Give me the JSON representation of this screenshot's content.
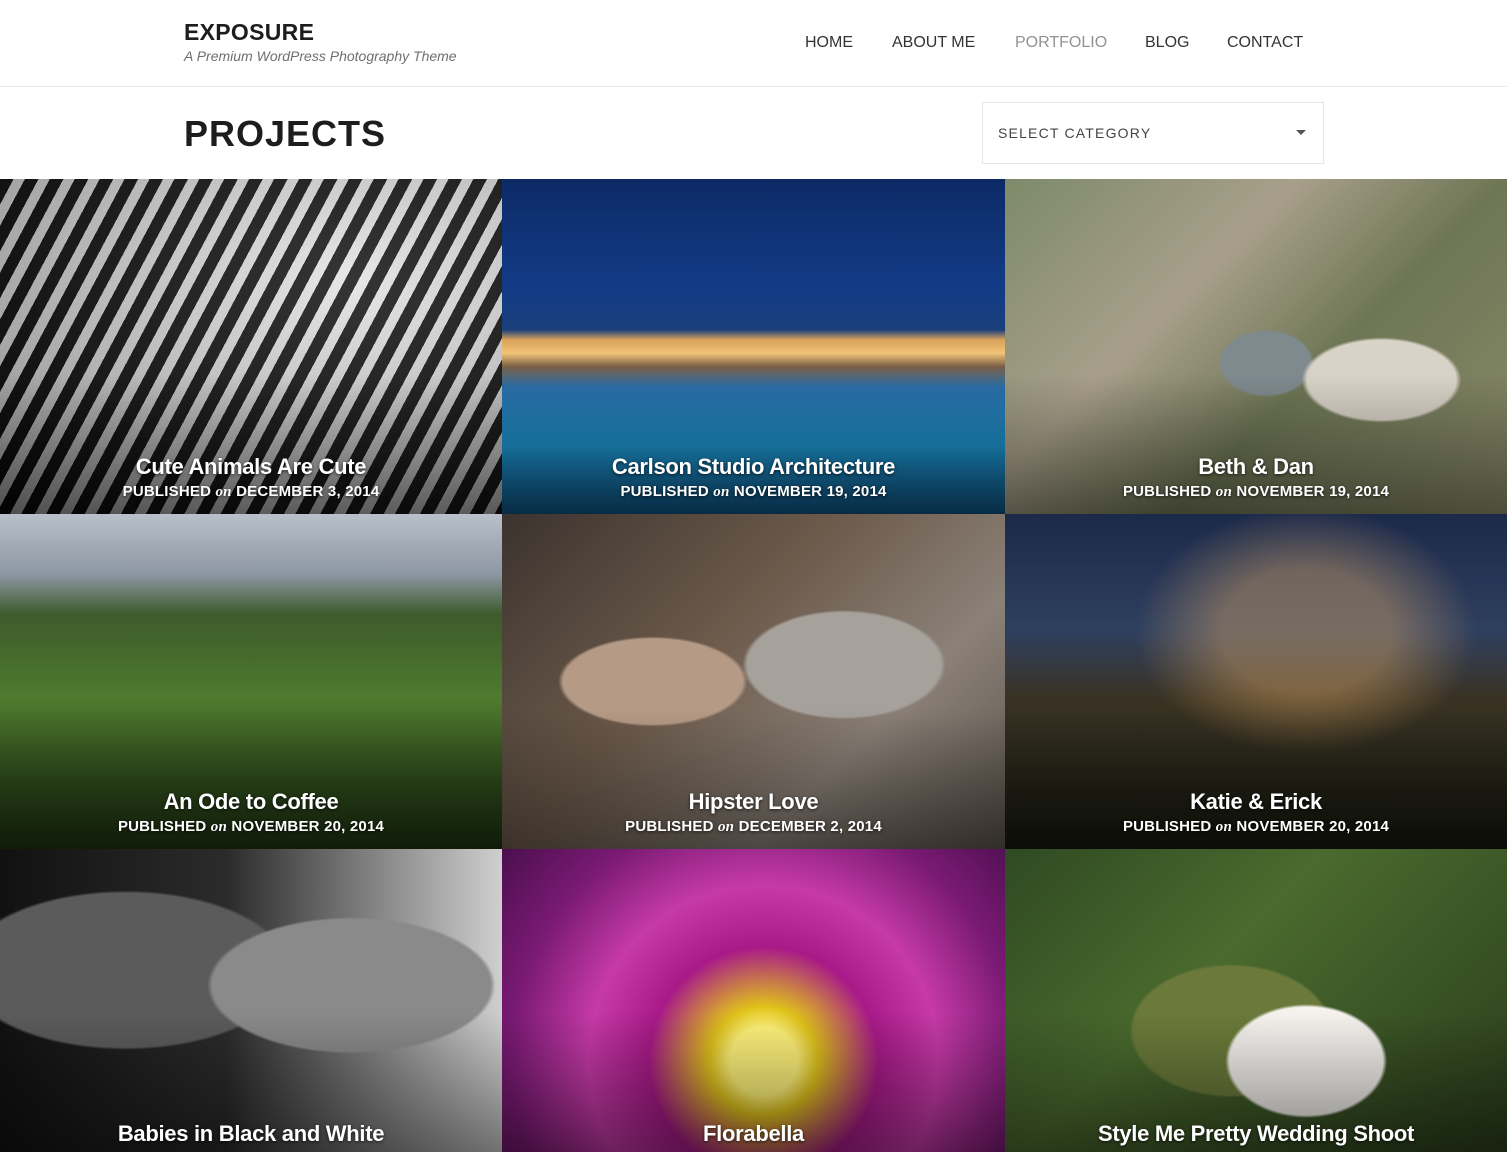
{
  "site": {
    "title": "EXPOSURE",
    "tagline": "A Premium WordPress Photography Theme"
  },
  "nav": {
    "items": [
      {
        "label": "HOME",
        "active": false
      },
      {
        "label": "ABOUT ME",
        "active": false
      },
      {
        "label": "PORTFOLIO",
        "active": true
      },
      {
        "label": "BLOG",
        "active": false
      },
      {
        "label": "CONTACT",
        "active": false
      }
    ]
  },
  "page": {
    "title": "PROJECTS",
    "category_select": {
      "selected": "SELECT CATEGORY"
    }
  },
  "projects": [
    {
      "title": "Cute Animals Are Cute",
      "published_prefix": "PUBLISHED",
      "on": "on",
      "date": "DECEMBER 3, 2014"
    },
    {
      "title": "Carlson Studio Architecture",
      "published_prefix": "PUBLISHED",
      "on": "on",
      "date": "NOVEMBER 19, 2014"
    },
    {
      "title": "Beth & Dan",
      "published_prefix": "PUBLISHED",
      "on": "on",
      "date": "NOVEMBER 19, 2014"
    },
    {
      "title": "An Ode to Coffee",
      "published_prefix": "PUBLISHED",
      "on": "on",
      "date": "NOVEMBER 20, 2014"
    },
    {
      "title": "Hipster Love",
      "published_prefix": "PUBLISHED",
      "on": "on",
      "date": "DECEMBER 2, 2014"
    },
    {
      "title": "Katie & Erick",
      "published_prefix": "PUBLISHED",
      "on": "on",
      "date": "NOVEMBER 20, 2014"
    },
    {
      "title": "Babies in Black and White"
    },
    {
      "title": "Florabella"
    },
    {
      "title": "Style Me Pretty Wedding Shoot"
    }
  ],
  "colors": {
    "nav_text": "#333333",
    "nav_active": "#8f9396",
    "title_text": "#1d1d1d"
  }
}
